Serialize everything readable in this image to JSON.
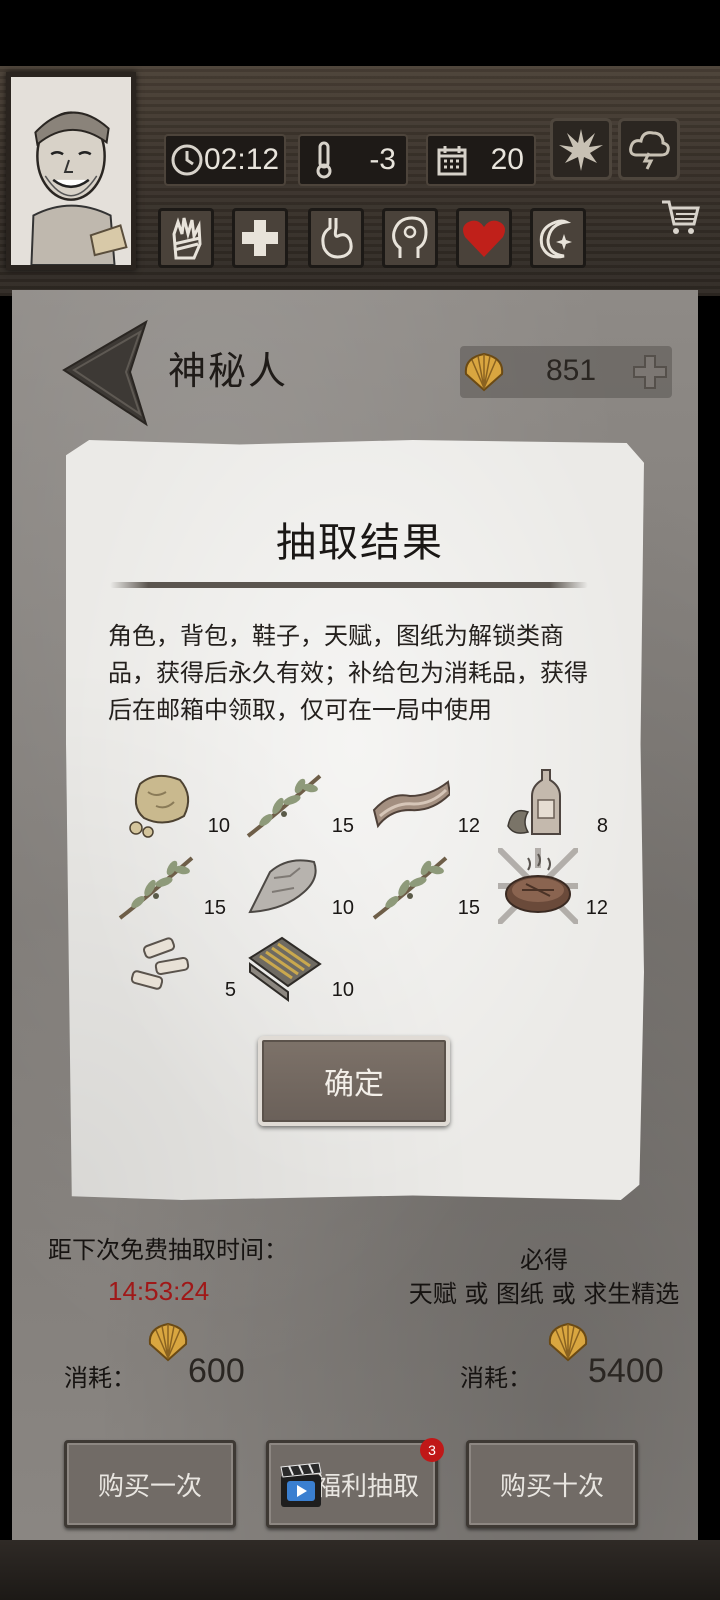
{
  "hud": {
    "time": "02:12",
    "temperature": "-3",
    "day": "20",
    "icons": [
      "clock-icon",
      "thermometer-icon",
      "calendar-icon",
      "leaf-icon",
      "storm-icon",
      "cart-icon"
    ],
    "status_icons": [
      "hand-bandage-icon",
      "health-cross-icon",
      "stomach-icon",
      "head-icon",
      "heart-icon",
      "moon-star-icon"
    ]
  },
  "header": {
    "title": "神秘人",
    "currency_value": "851"
  },
  "result": {
    "title": "抽取结果",
    "description": "角色，背包，鞋子，天赋，图纸为解锁类商品，获得后永久有效；补给包为消耗品，获得后在邮箱中领取，仅可在一局中使用",
    "items": [
      {
        "icon": "stone-icon",
        "qty": "10"
      },
      {
        "icon": "herb-branch-icon",
        "qty": "15"
      },
      {
        "icon": "bacon-icon",
        "qty": "12"
      },
      {
        "icon": "bottle-icon",
        "qty": "8"
      },
      {
        "icon": "herb-branch-icon",
        "qty": "15"
      },
      {
        "icon": "flint-icon",
        "qty": "10"
      },
      {
        "icon": "herb-branch-icon",
        "qty": "15"
      },
      {
        "icon": "steak-icon",
        "qty": "12"
      },
      {
        "icon": "bone-icon",
        "qty": "5"
      },
      {
        "icon": "plank-icon",
        "qty": "10"
      }
    ],
    "confirm_label": "确定"
  },
  "free_draw": {
    "label": "距下次免费抽取时间：",
    "timer": "14:53:24"
  },
  "guarantee": {
    "title": "必得",
    "desc": "天赋 或 图纸 或 求生精选"
  },
  "costs": {
    "label_left": "消耗：",
    "value_left": "600",
    "label_right": "消耗：",
    "value_right": "5400"
  },
  "buttons": {
    "buy_once": "购买一次",
    "free_draw": "福利抽取",
    "free_draw_badge": "3",
    "buy_ten": "购买十次"
  },
  "colors": {
    "timer_red": "#a01818",
    "heart_red": "#c0201a",
    "shell_gold": "#d9a640"
  }
}
